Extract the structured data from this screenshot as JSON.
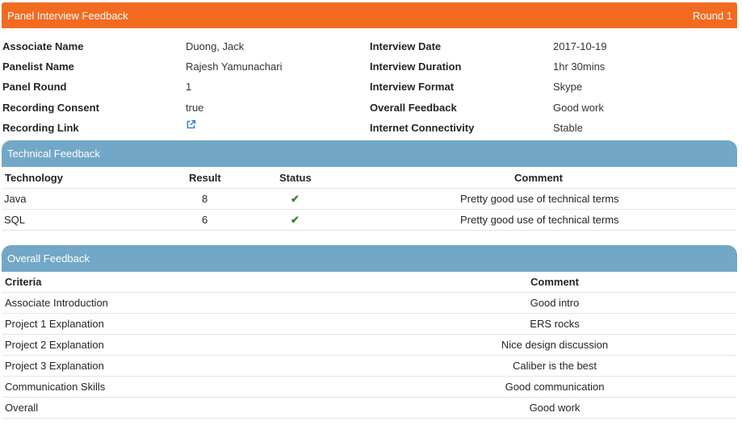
{
  "header": {
    "title": "Panel Interview Feedback",
    "round": "Round 1"
  },
  "info": [
    {
      "label1": "Associate Name",
      "value1": "Duong, Jack",
      "label2": "Interview Date",
      "value2": "2017-10-19"
    },
    {
      "label1": "Panelist Name",
      "value1": "Rajesh Yamunachari",
      "label2": "Interview Duration",
      "value2": "1hr 30mins"
    },
    {
      "label1": "Panel Round",
      "value1": "1",
      "label2": "Interview Format",
      "value2": "Skype"
    },
    {
      "label1": "Recording Consent",
      "value1": "true",
      "label2": "Overall Feedback",
      "value2": "Good work"
    },
    {
      "label1": "Recording Link",
      "value1_icon": "external-link-icon",
      "label2": "Internet Connectivity",
      "value2": "Stable"
    }
  ],
  "technical": {
    "title": "Technical Feedback",
    "headers": {
      "technology": "Technology",
      "result": "Result",
      "status": "Status",
      "comment": "Comment"
    },
    "rows": [
      {
        "technology": "Java",
        "result": "8",
        "status": "check-icon",
        "comment": "Pretty good use of technical terms"
      },
      {
        "technology": "SQL",
        "result": "6",
        "status": "check-icon",
        "comment": "Pretty good use of technical terms"
      }
    ]
  },
  "overall": {
    "title": "Overall Feedback",
    "headers": {
      "criteria": "Criteria",
      "comment": "Comment"
    },
    "rows": [
      {
        "criteria": "Associate Introduction",
        "comment": "Good intro"
      },
      {
        "criteria": "Project 1 Explanation",
        "comment": "ERS rocks"
      },
      {
        "criteria": "Project 2 Explanation",
        "comment": "Nice design discussion"
      },
      {
        "criteria": "Project 3 Explanation",
        "comment": "Caliber is the best"
      },
      {
        "criteria": "Communication Skills",
        "comment": "Good communication"
      },
      {
        "criteria": "Overall",
        "comment": "Good work"
      }
    ]
  },
  "colors": {
    "header": "#f26b21",
    "section": "#72a7c7",
    "check": "#2e8b2e",
    "link": "#2e7bd6"
  }
}
